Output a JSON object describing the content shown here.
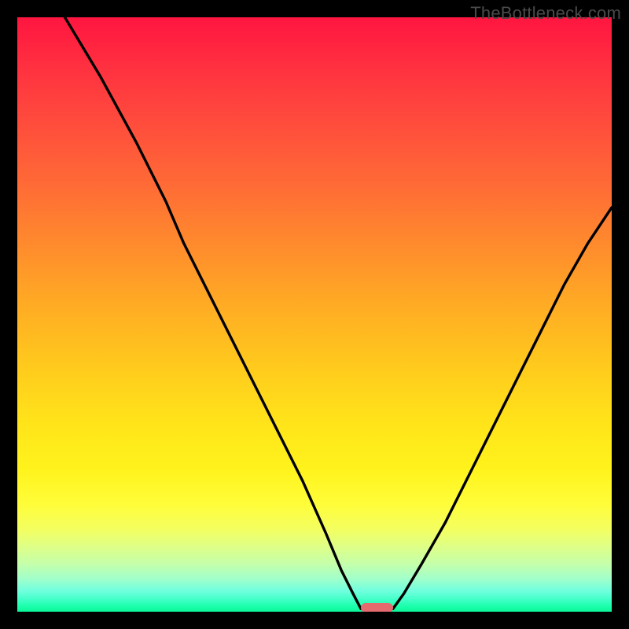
{
  "watermark": "TheBottleneck.com",
  "chart_data": {
    "type": "line",
    "title": "",
    "xlabel": "",
    "ylabel": "",
    "xlim": [
      0,
      100
    ],
    "ylim": [
      0,
      100
    ],
    "grid": false,
    "legend": false,
    "series": [
      {
        "name": "left-curve",
        "x": [
          8,
          14,
          20,
          25,
          28,
          32,
          36,
          40,
          44,
          48,
          52,
          54.5,
          56.5,
          57.8
        ],
        "y": [
          100,
          90,
          79,
          69,
          62,
          54,
          46,
          38,
          30,
          22,
          13,
          7,
          3,
          0.5
        ]
      },
      {
        "name": "right-curve",
        "x": [
          63.2,
          65,
          68,
          72,
          76,
          80,
          84,
          88,
          92,
          96,
          100
        ],
        "y": [
          0.5,
          3,
          8,
          15,
          23,
          31,
          39,
          47,
          55,
          62,
          68
        ]
      }
    ],
    "marker": {
      "name": "bottom-pill",
      "x_center_pct": 60.5,
      "width_pct": 5.5,
      "color": "#e46a6e"
    },
    "background_gradient": {
      "top": "#ff1540",
      "mid": "#ffe31a",
      "bottom": "#0af79a"
    }
  }
}
